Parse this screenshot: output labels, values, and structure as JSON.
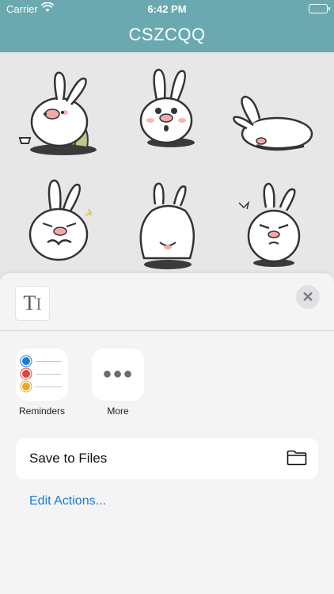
{
  "status_bar": {
    "carrier": "Carrier",
    "time": "6:42 PM"
  },
  "nav": {
    "title": "CSZCQQ"
  },
  "stickers": [
    "bunny-sticker-1",
    "bunny-sticker-2",
    "bunny-sticker-3",
    "bunny-sticker-4",
    "bunny-sticker-5",
    "bunny-sticker-6"
  ],
  "share_sheet": {
    "apps": [
      {
        "label": "Reminders",
        "icon": "reminders-icon"
      },
      {
        "label": "More",
        "icon": "more-icon"
      }
    ],
    "actions": [
      {
        "label": "Save to Files",
        "icon": "folder-icon"
      }
    ],
    "edit_actions": "Edit Actions..."
  },
  "colors": {
    "nav_bar": "#6aa9b0",
    "link": "#1a7dd6",
    "reminder_dots": [
      "#1a7dd6",
      "#e0453b",
      "#f2a51f"
    ]
  }
}
